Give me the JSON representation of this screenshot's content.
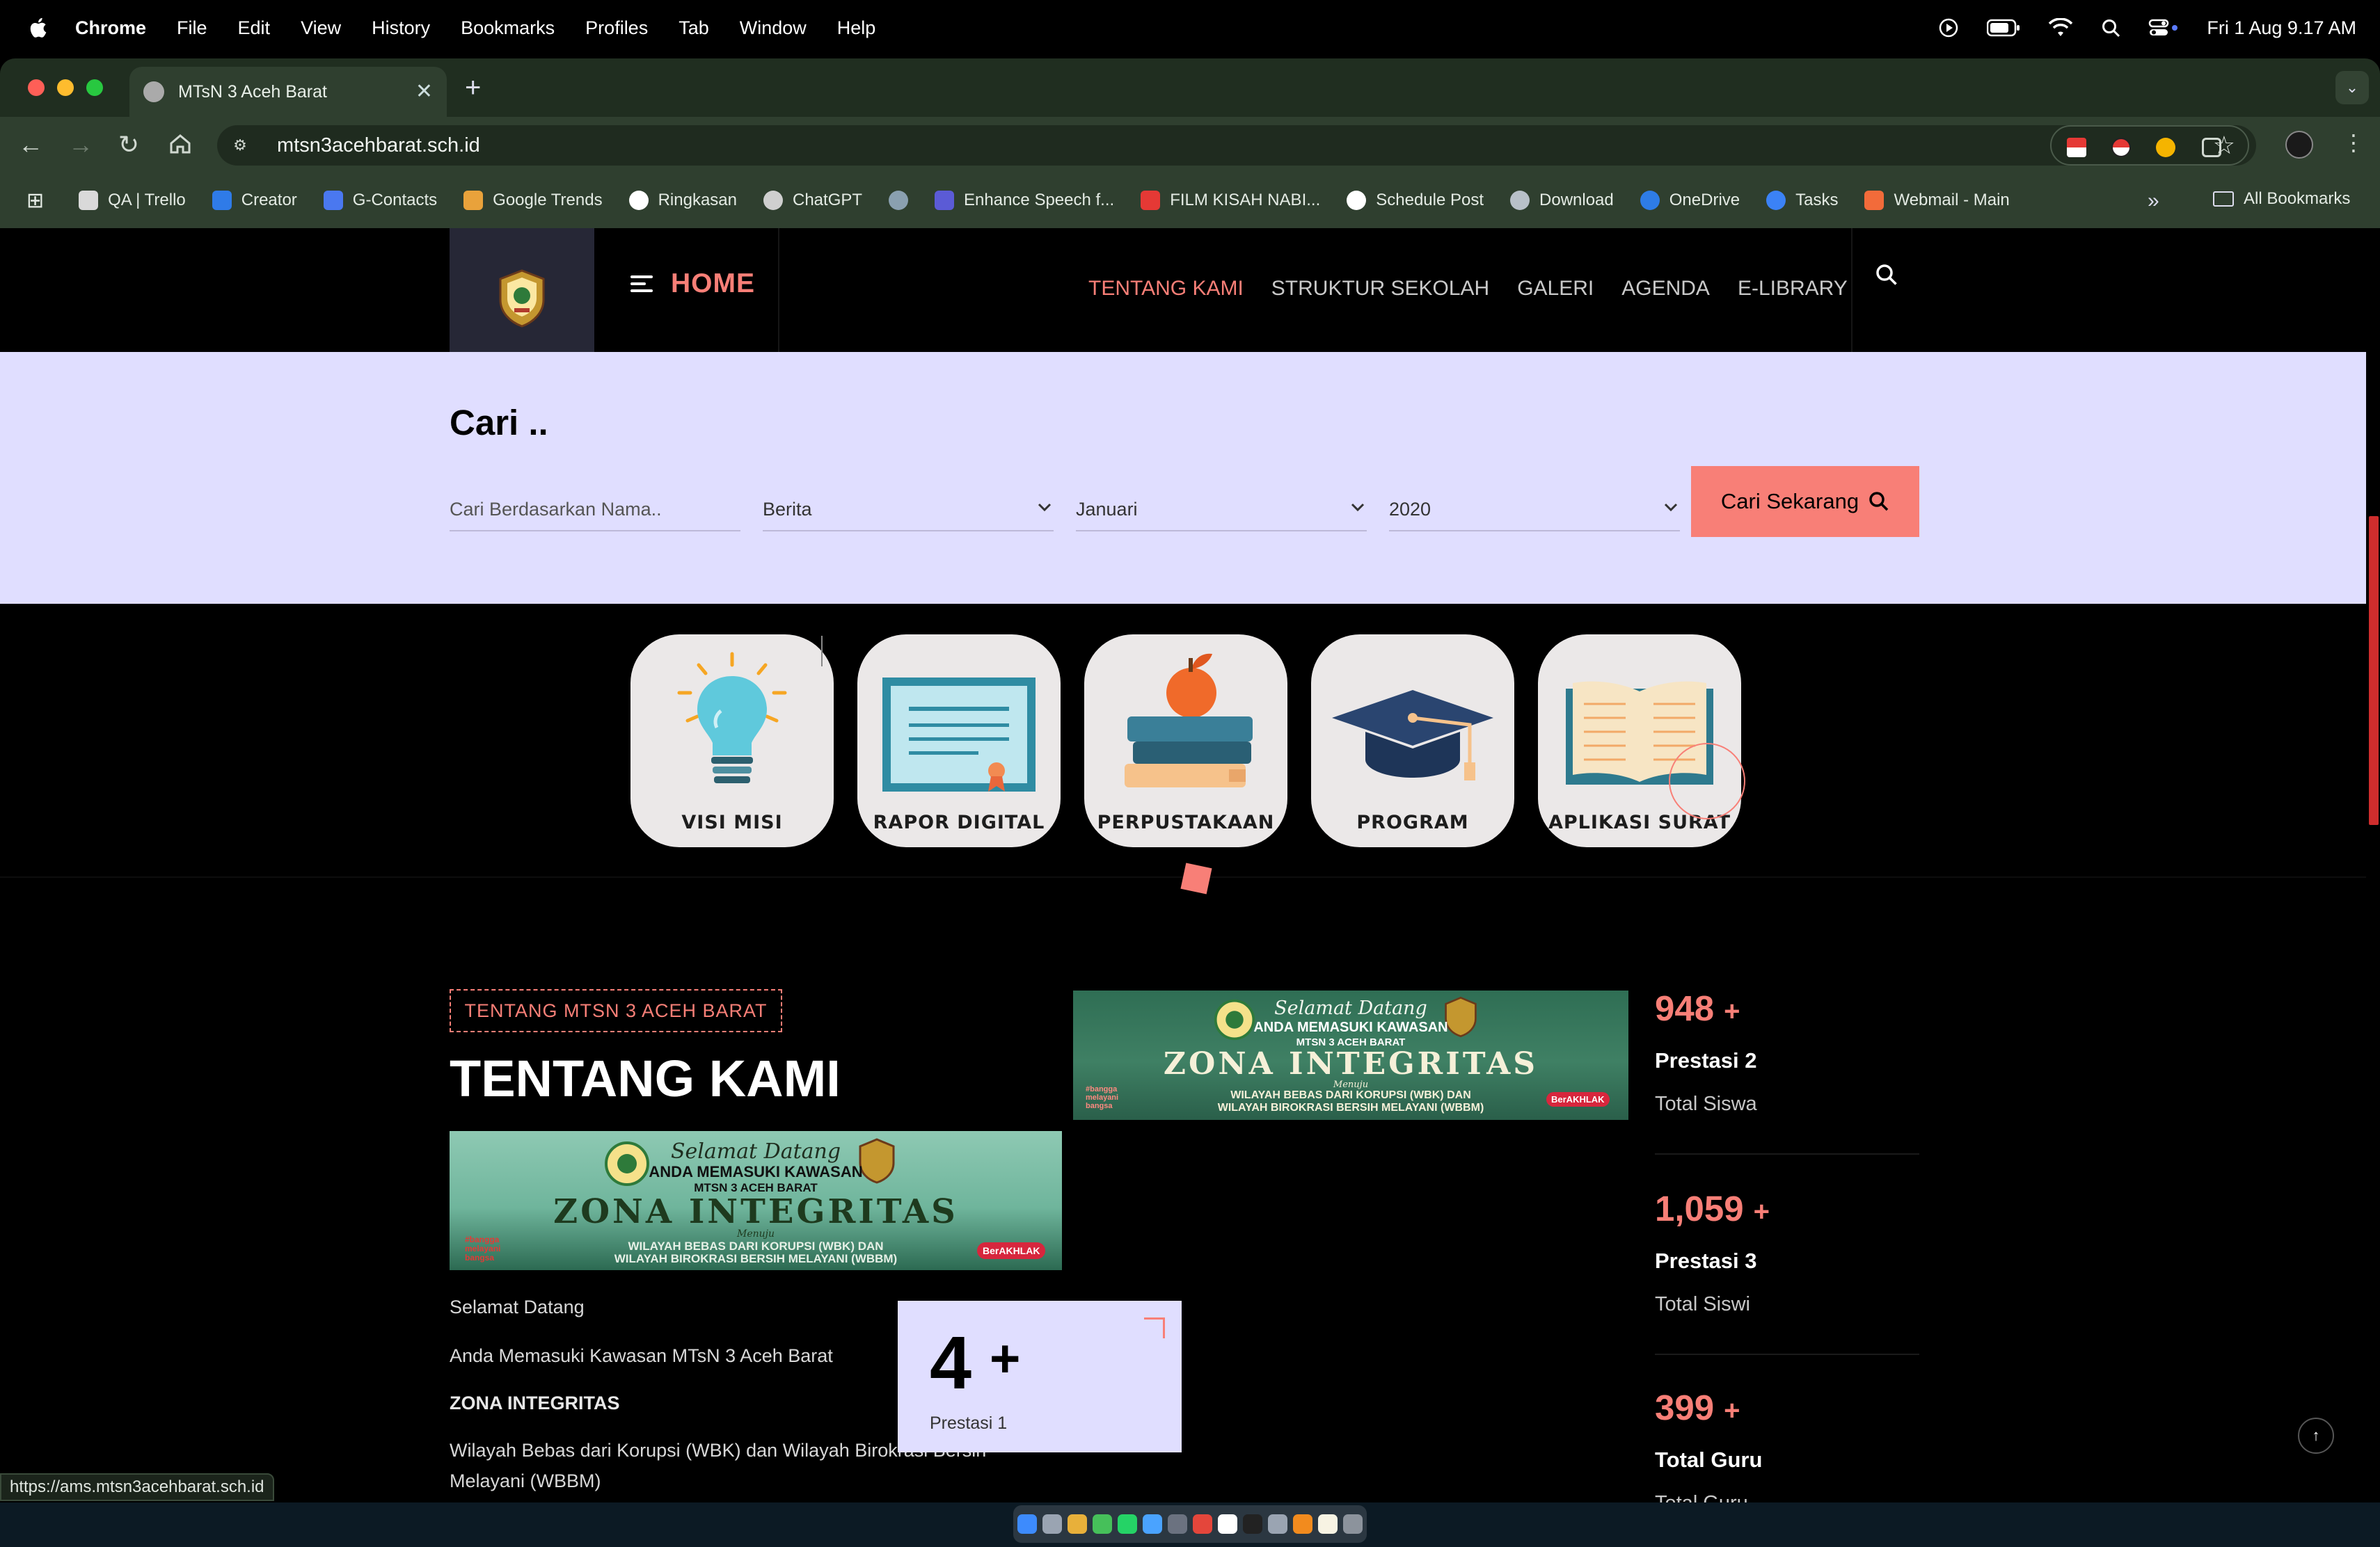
{
  "menubar": {
    "app_name": "Chrome",
    "items": [
      "File",
      "Edit",
      "View",
      "History",
      "Bookmarks",
      "Profiles",
      "Tab",
      "Window",
      "Help"
    ],
    "clock": "Fri 1 Aug  9.17 AM"
  },
  "browser": {
    "tab_title": "MTsN 3 Aceh Barat",
    "new_tab_symbol": "+",
    "url": "mtsn3acehbarat.sch.id",
    "status_url": "https://ams.mtsn3acehbarat.sch.id",
    "bookmarks": [
      {
        "label": "QA | Trello",
        "color": "#d9d9d9"
      },
      {
        "label": "Creator",
        "color": "#2f7be8"
      },
      {
        "label": "G-Contacts",
        "color": "#4a78f0"
      },
      {
        "label": "Google Trends",
        "color": "#e9a23b"
      },
      {
        "label": "Ringkasan",
        "color": "#ffffff"
      },
      {
        "label": "ChatGPT",
        "color": "#cfcfcf"
      },
      {
        "label": "",
        "color": "#8aa0b0"
      },
      {
        "label": "Enhance Speech f...",
        "color": "#5b5bd6"
      },
      {
        "label": "FILM KISAH NABI...",
        "color": "#e53935"
      },
      {
        "label": "Schedule Post",
        "color": "#ffffff"
      },
      {
        "label": "Download",
        "color": "#b8c0c8"
      },
      {
        "label": "OneDrive",
        "color": "#2e7ce6"
      },
      {
        "label": "Tasks",
        "color": "#3b82f6"
      },
      {
        "label": "Webmail - Main",
        "color": "#f26b3a"
      }
    ],
    "more_symbol": "»",
    "all_bookmarks": "All Bookmarks"
  },
  "site": {
    "home_label": "HOME",
    "nav": [
      "TENTANG KAMI",
      "STRUKTUR SEKOLAH",
      "GALERI",
      "AGENDA",
      "E-LIBRARY"
    ],
    "search": {
      "title": "Cari ..",
      "name_placeholder": "Cari Berdasarkan Nama..",
      "category": "Berita",
      "month": "Januari",
      "year": "2020",
      "button": "Cari Sekarang"
    },
    "quick_links": [
      "VISI MISI",
      "RAPOR DIGITAL",
      "PERPUSTAKAAN",
      "PROGRAM",
      "APLIKASI SURAT"
    ],
    "about": {
      "badge": "TENTANG MTSN 3 ACEH BARAT",
      "title": "TENTANG KAMI",
      "p1": "Selamat Datang",
      "p2": "Anda Memasuki Kawasan MTsN 3 Aceh Barat",
      "p3": "ZONA INTEGRITAS",
      "p4a": "Wilayah Bebas dari Korupsi (WBK) dan Wilayah Birokrasi Bersih",
      "p4b": "Melayani (WBBM)"
    },
    "banner": {
      "welcome": "Selamat Datang",
      "line1": "ANDA MEMASUKI KAWASAN",
      "line2": "MTSN 3 ACEH BARAT",
      "headline": "ZONA INTEGRITAS",
      "menuju": "Menuju",
      "footer1": "WILAYAH BEBAS DARI KORUPSI (WBK) DAN",
      "footer2": "WILAYAH BIROKRASI BERSIH MELAYANI (WBBM)",
      "logo_left": "#bangga melayani bangsa",
      "logo_right": "BerAKHLAK"
    },
    "prestasi_box": {
      "number": "4",
      "plus": "+",
      "label": "Prestasi 1"
    },
    "stats": [
      {
        "number": "948",
        "plus": "+",
        "title": "Prestasi 2",
        "subtitle": "Total Siswa"
      },
      {
        "number": "1,059",
        "plus": "+",
        "title": "Prestasi 3",
        "subtitle": "Total Siswi"
      },
      {
        "number": "399",
        "plus": "+",
        "title": "Total Guru",
        "subtitle": "Total Guru"
      }
    ],
    "accent": "#f87f77",
    "search_band_color": "#e0deff"
  }
}
